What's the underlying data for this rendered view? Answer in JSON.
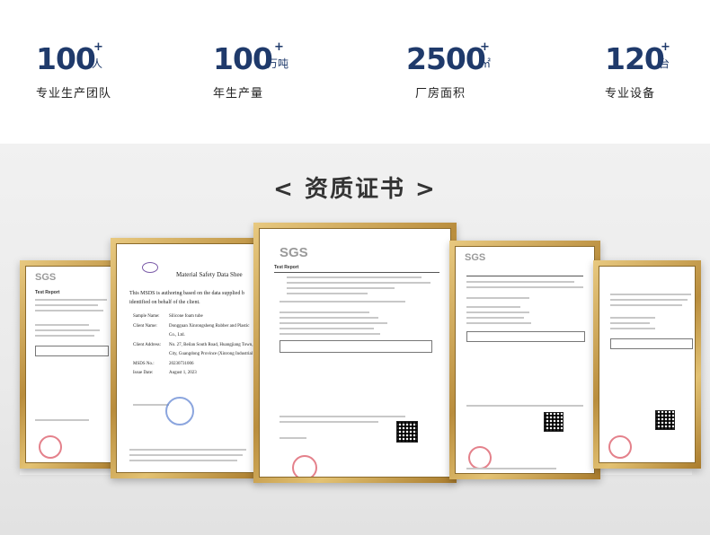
{
  "stats": [
    {
      "number": "100",
      "plus": "+",
      "unit": "人",
      "label": "专业生产团队"
    },
    {
      "number": "100",
      "plus": "+",
      "unit": "万吨",
      "label": "年生产量"
    },
    {
      "number": "2500",
      "plus": "+",
      "unit": "㎡",
      "label": "厂房面积"
    },
    {
      "number": "120",
      "plus": "+",
      "unit": "台",
      "label": "专业设备"
    }
  ],
  "certificates": {
    "title": "< 资质证书 >",
    "sgs_logo": "SGS",
    "test_report_label": "Test Report",
    "msds_title": "Material Safety Data Shee",
    "msds_intro": "This MSDS is authoring based on the data supplied b",
    "msds_intro2": "identified on behalf of the client.",
    "sample_name_label": "Sample Name:",
    "sample_name_value": "Silicone foam tube",
    "client_name_label": "Client Name:",
    "client_name_value": "Dongguan Xinrongsheng Rubber and Plastic",
    "client_name_value2": "Co., Ltd.",
    "client_address_label": "Client Address:",
    "client_address_value": "No. 27, Beilan South Road, Huangjiang Town,",
    "client_address_value2": "City, Guangdong Province (Xinrong Industrial",
    "msds_no_label": "MSDS No.:",
    "msds_no_value": "20230731006",
    "issue_date_label": "Issue Date:",
    "issue_date_value": "August 1, 2023"
  },
  "colors": {
    "accent": "#1f3a6b",
    "frame_gold": "#c9a24f",
    "stamp_red": "#d94c5a"
  }
}
